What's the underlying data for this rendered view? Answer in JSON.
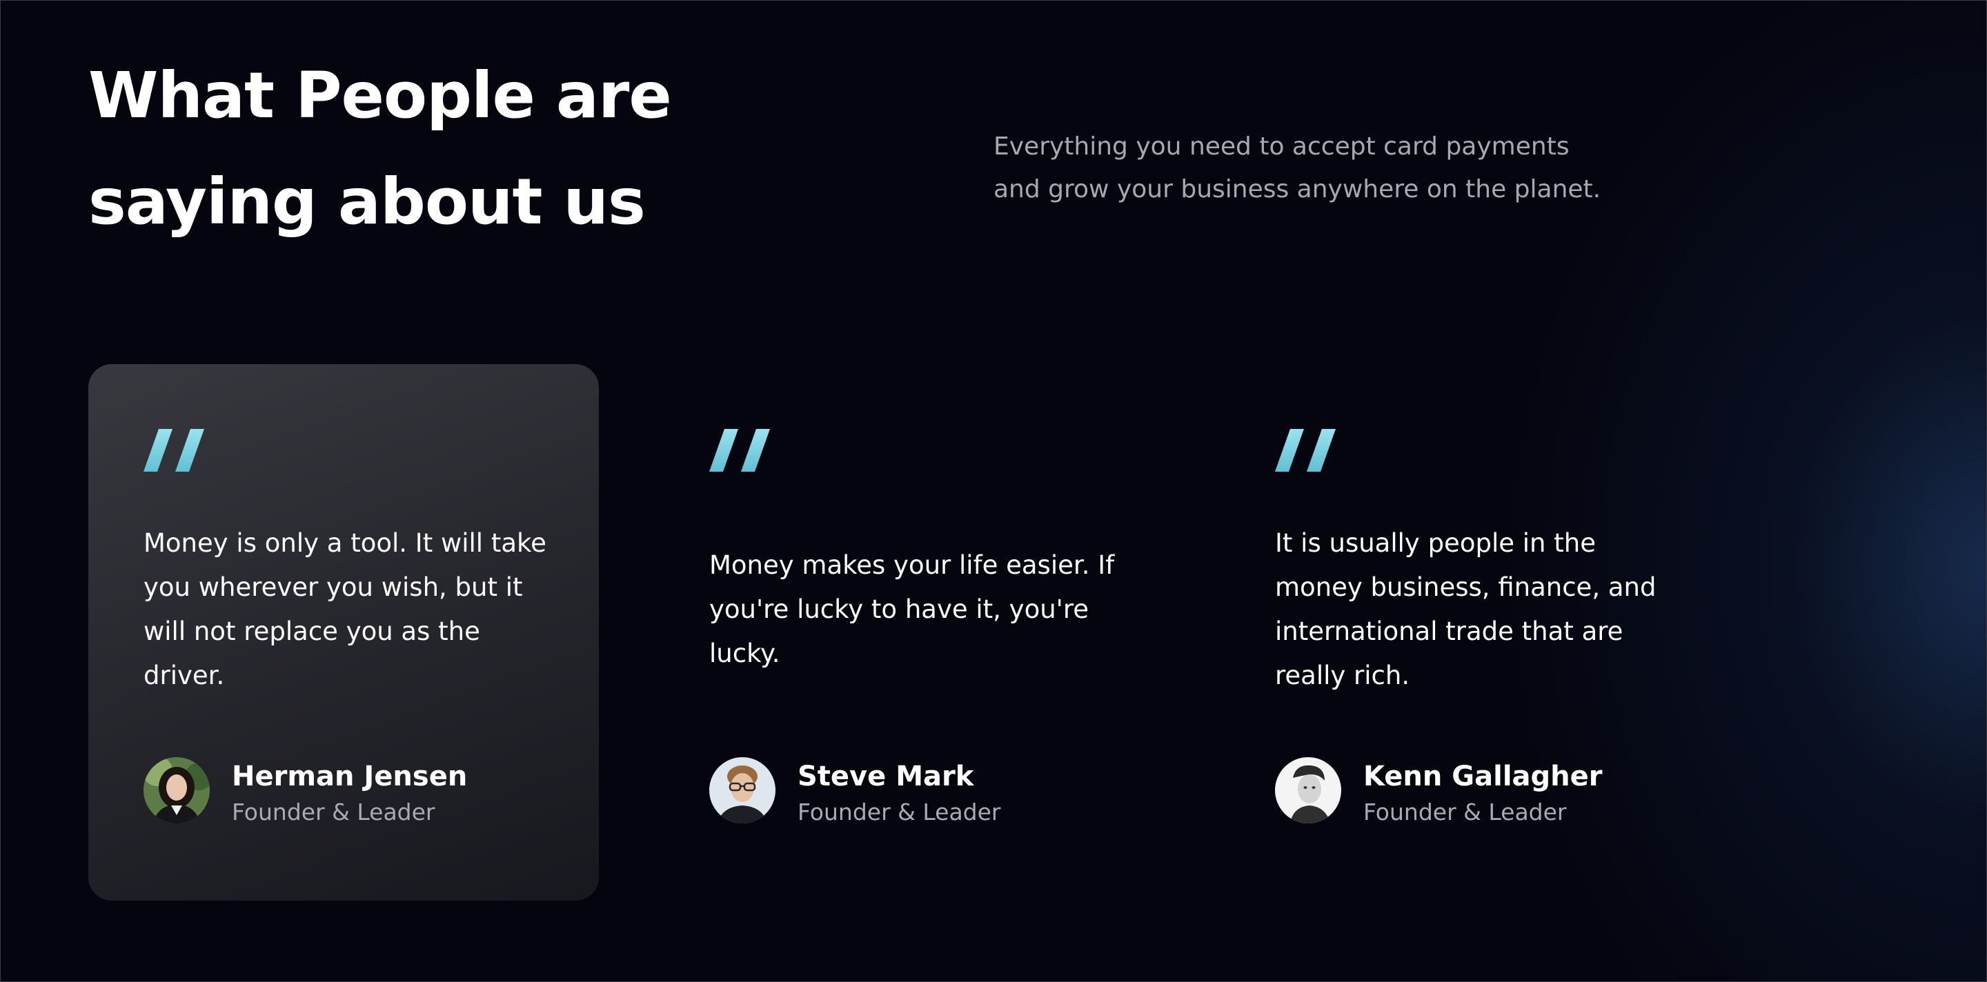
{
  "section": {
    "heading_line1": "What People are",
    "heading_line2": "saying about us",
    "subtitle_line1": "Everything you need to accept card payments",
    "subtitle_line2": "and grow your business anywhere on the planet."
  },
  "colors": {
    "background": "#04050f",
    "active_card": "#2c2c33",
    "quote_mark": "#7fd3e3",
    "text_primary": "#ffffff",
    "text_secondary": "#a7a9b1"
  },
  "testimonials": [
    {
      "quote": "Money is only a tool. It will take you wherever you wish, but it will not replace you as the driver.",
      "name": "Herman Jensen",
      "role": "Founder & Leader",
      "icon": "quote-icon",
      "active": true
    },
    {
      "quote": "Money makes your life easier. If you're lucky to have it, you're lucky.",
      "name": "Steve Mark",
      "role": "Founder & Leader",
      "icon": "quote-icon",
      "active": false
    },
    {
      "quote": "It is usually people in the money business, finance, and international trade that are really rich.",
      "name": "Kenn Gallagher",
      "role": "Founder & Leader",
      "icon": "quote-icon",
      "active": false
    }
  ]
}
